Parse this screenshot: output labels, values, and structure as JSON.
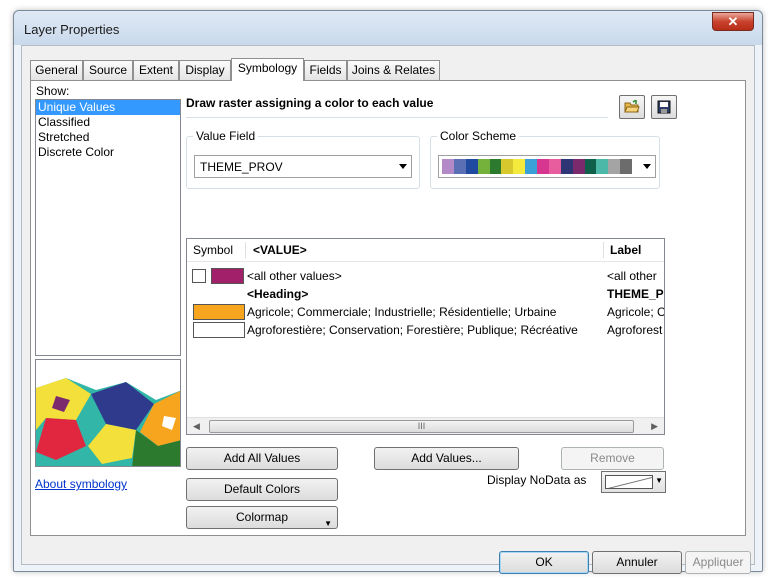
{
  "window": {
    "title": "Layer Properties",
    "close_glyph": "✕"
  },
  "tabs": [
    {
      "label": "General"
    },
    {
      "label": "Source"
    },
    {
      "label": "Extent"
    },
    {
      "label": "Display"
    },
    {
      "label": "Symbology",
      "active": true
    },
    {
      "label": "Fields"
    },
    {
      "label": "Joins & Relates"
    }
  ],
  "show": {
    "label": "Show:",
    "items": [
      {
        "label": "Unique Values",
        "selected": true
      },
      {
        "label": "Classified"
      },
      {
        "label": "Stretched"
      },
      {
        "label": "Discrete Color"
      }
    ]
  },
  "description": "Draw raster assigning a color to each value",
  "icons": {
    "open": "folder-open-icon",
    "save": "save-icon"
  },
  "value_field": {
    "label": "Value Field",
    "value": "THEME_PROV"
  },
  "color_scheme": {
    "label": "Color Scheme",
    "colors": [
      "#b489c8",
      "#5a6fb4",
      "#1f4aa0",
      "#74b23b",
      "#2c7a2d",
      "#d7c92d",
      "#f4ea3c",
      "#3aa0d8",
      "#d6368f",
      "#e85d9e",
      "#2e3575",
      "#7a2a6d",
      "#0f5f4a",
      "#4cb8a8",
      "#a4a4a4",
      "#6c6c6c"
    ]
  },
  "table": {
    "headers": {
      "symbol": "Symbol",
      "value": "<VALUE>",
      "label": "Label"
    },
    "rows": [
      {
        "value": "<all other values>",
        "label": "<all other",
        "bold": false,
        "color": "#a21f6a",
        "checkbox": true
      },
      {
        "value": "<Heading>",
        "label": "THEME_P",
        "bold": true,
        "color": null,
        "checkbox": false
      },
      {
        "value": "Agricole; Commerciale; Industrielle; Résidentielle; Urbaine",
        "label": "Agricole; C",
        "bold": false,
        "color": "#f7a51f",
        "checkbox": false
      },
      {
        "value": "Agroforestière; Conservation; Forestière; Publique; Récréative",
        "label": "Agroforest",
        "bold": false,
        "color": "#ffffff",
        "checkbox": false
      }
    ],
    "scroll_glyph": "III"
  },
  "buttons": {
    "add_all": "Add All Values",
    "add_values": "Add Values...",
    "remove": "Remove",
    "default_colors": "Default Colors",
    "colormap": "Colormap"
  },
  "about_link": "About symbology",
  "nodata_label": "Display NoData as",
  "footer": {
    "ok": "OK",
    "cancel": "Annuler",
    "apply": "Appliquer"
  }
}
